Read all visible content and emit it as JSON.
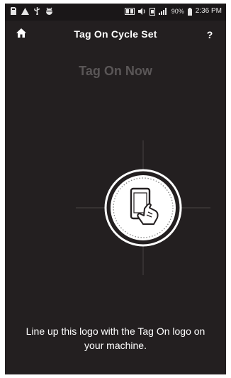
{
  "status_bar": {
    "battery_percent": "90%",
    "time": "2:36 PM",
    "icons": [
      "sd-card-icon",
      "warning-icon",
      "usb-icon",
      "android-debug-icon",
      "nfc-icon",
      "volume-icon",
      "vibrate-icon",
      "signal-icon",
      "battery-icon"
    ]
  },
  "header": {
    "title": "Tag On Cycle Set",
    "home_icon": "home-icon",
    "help_label": "?"
  },
  "main": {
    "heading": "Tag On Now",
    "logo_icon": "tag-on-phone-hand-icon",
    "instruction": "Line up this logo with the Tag On logo on your machine."
  },
  "colors": {
    "background": "#231f20",
    "heading_dim": "#5a5657",
    "text": "#ffffff"
  }
}
